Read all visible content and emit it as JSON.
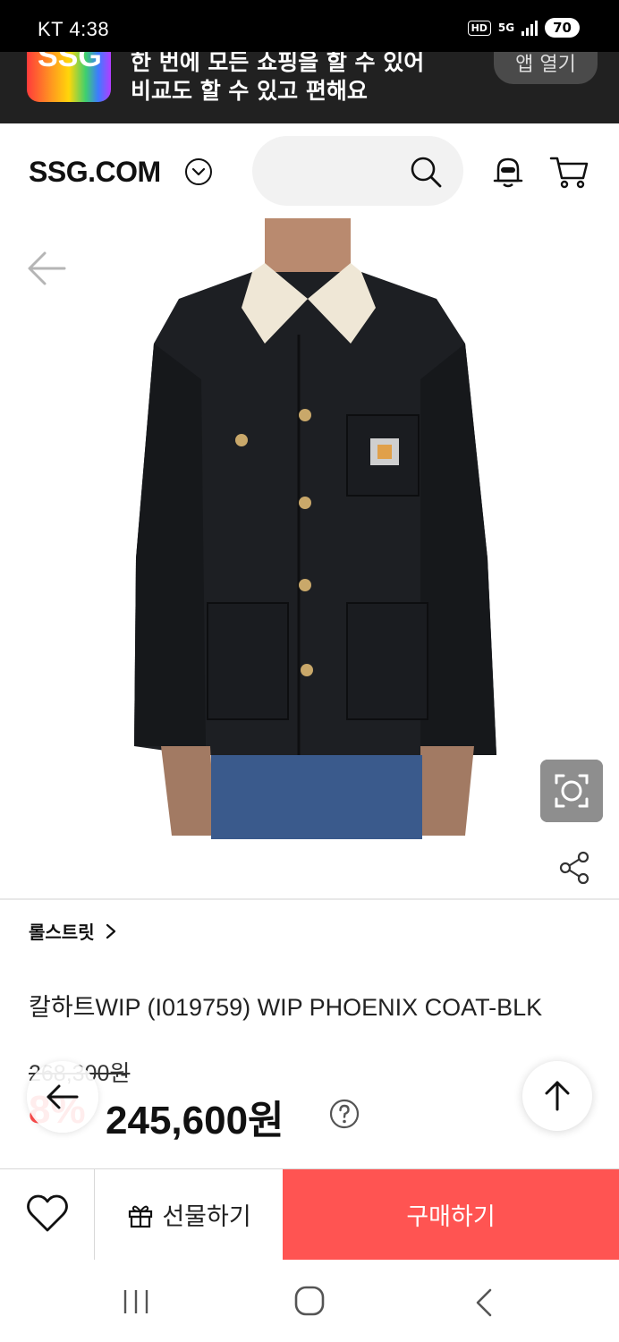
{
  "status_bar": {
    "carrier_time": "KT 4:38",
    "hd": "HD",
    "network": "5G",
    "battery": "70"
  },
  "app_banner": {
    "logo_text": "SSG",
    "line1": "한 번에 모든 쇼핑을 할 수 있어",
    "line2": "비교도 할 수 있고 편해요",
    "open_button": "앱 열기"
  },
  "header": {
    "brand": "SSG.COM",
    "search_placeholder": ""
  },
  "product": {
    "store": "롤스트릿",
    "title": "칼하트WIP (I019759) WIP PHOENIX COAT-BLK",
    "original_price": "268,300원",
    "discount": "8%",
    "price": "245,600원"
  },
  "bottom_bar": {
    "gift_label": "선물하기",
    "buy_label": "구매하기"
  },
  "colors": {
    "buy_button": "#ff5452",
    "discount": "#ff4d4d",
    "banner_bg": "#212121"
  }
}
